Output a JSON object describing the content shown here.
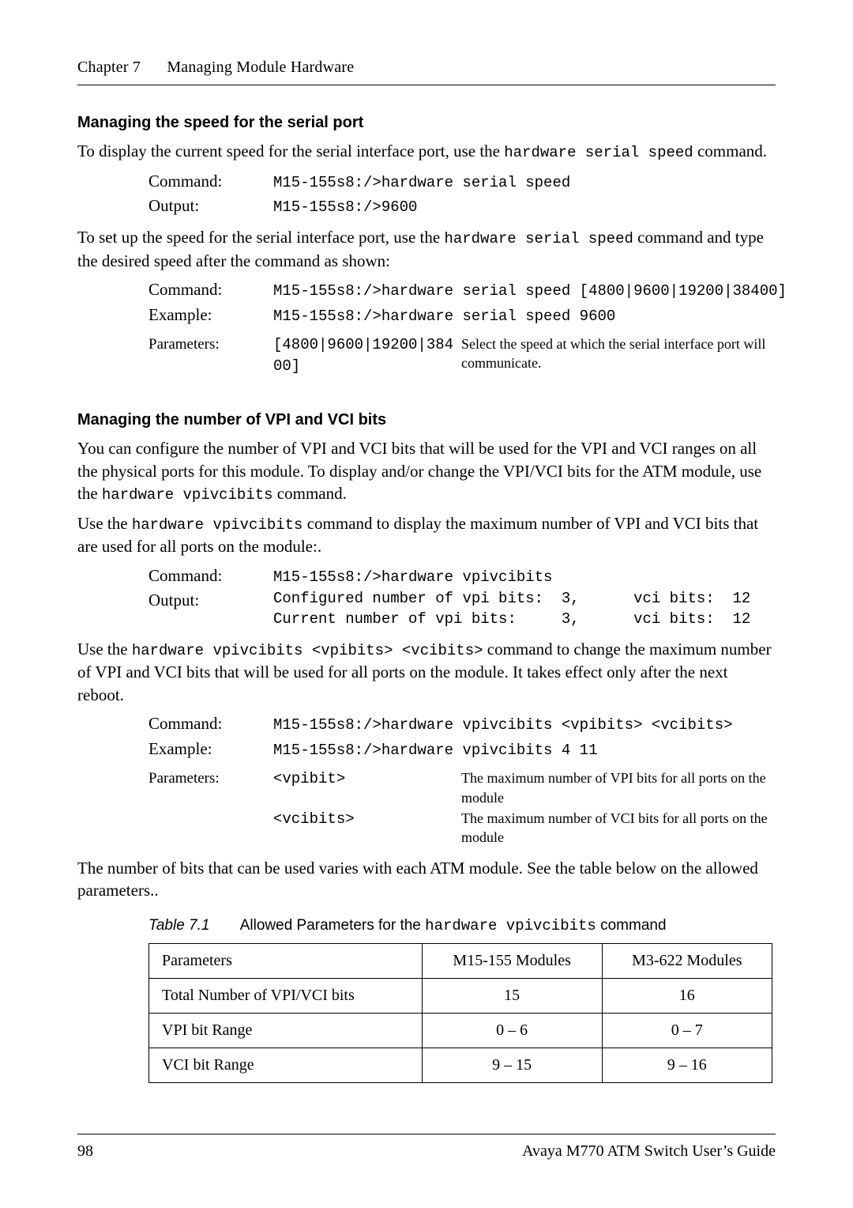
{
  "runhead": {
    "chapter": "Chapter 7",
    "title": "Managing Module Hardware"
  },
  "sec1": {
    "heading": "Managing the speed for the serial port",
    "p1a": "To display the current speed for the serial interface port, use the ",
    "p1code": "hardware serial speed",
    "p1b": " command.",
    "cmd_label": "Command:",
    "out_label": "Output:",
    "cmd_val": "M15-155s8:/>hardware serial speed",
    "out_val": "M15-155s8:/>9600",
    "p2a": "To set up the speed for the serial interface port, use the ",
    "p2code": "hardware serial speed",
    "p2b": " command and type the desired speed after the command as shown:",
    "cmd2_label": "Command:",
    "cmd2_val": "M15-155s8:/>hardware serial speed [4800|9600|19200|38400]",
    "ex_label": "Example:",
    "ex_val": "M15-155s8:/>hardware serial speed  9600",
    "param_label": "Parameters:",
    "param_arg": "[4800|9600|19200|384\n00]",
    "param_desc": "Select the speed at which the serial interface port will communicate."
  },
  "sec2": {
    "heading": "Managing the number of VPI and VCI bits",
    "p1": "You can configure the number of VPI and VCI bits that will be used for the VPI and VCI ranges on all the physical ports for this module. To display and/or change the VPI/VCI bits for the ATM module, use the ",
    "p1code": "hardware vpivcibits",
    "p1b": " command.",
    "p2a": "Use the ",
    "p2code": "hardware vpivcibits",
    "p2b": " command to display the maximum number of VPI and VCI bits that are used for all ports on the module:.",
    "cmd_label": "Command:",
    "cmd_val": "M15-155s8:/>hardware vpivcibits",
    "out_label": "Output:",
    "out_line1": "Configured number of vpi bits:  3,      vci bits:  12",
    "out_line2": "Current number of vpi bits:     3,      vci bits:  12",
    "p3a": "Use the ",
    "p3code": "hardware vpivcibits <vpibits> <vcibits>",
    "p3b": " command to change the maximum number of VPI and VCI bits that will be used for all ports on the module. It takes effect only after the next reboot.",
    "cmd2_label": "Command:",
    "cmd2_val": "M15-155s8:/>hardware vpivcibits <vpibits> <vcibits>",
    "ex_label": "Example:",
    "ex_val": "M15-155s8:/>hardware vpivcibits 4 11",
    "param_label": "Parameters:",
    "param1_arg": "<vpibit>",
    "param1_desc": "The maximum number of VPI bits for all ports on the module",
    "param2_arg": "<vcibits>",
    "param2_desc": "The maximum number of VCI bits for all ports on the module",
    "p4": "The number of bits that can be used varies with each ATM module.  See the table below on the allowed parameters.."
  },
  "table": {
    "num": "Table 7.1",
    "cap_a": "Allowed Parameters for the ",
    "cap_code": "hardware vpivcibits",
    "cap_b": " command",
    "h1": "Parameters",
    "h2": "M15-155 Modules",
    "h3": "M3-622 Modules",
    "r1c1": "Total Number of VPI/VCI bits",
    "r1c2": "15",
    "r1c3": "16",
    "r2c1": "VPI bit Range",
    "r2c2": "0 – 6",
    "r2c3": "0 – 7",
    "r3c1": "VCI bit Range",
    "r3c2": "9 – 15",
    "r3c3": "9 – 16"
  },
  "footer": {
    "page": "98",
    "book": "Avaya M770 ATM Switch User’s Guide"
  }
}
